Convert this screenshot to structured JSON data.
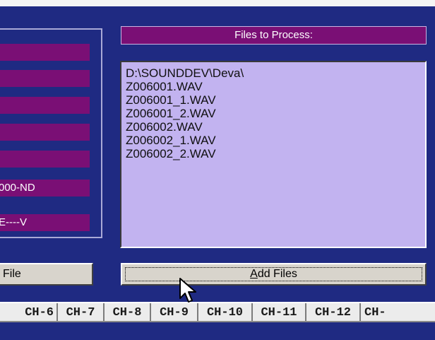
{
  "left_panel": {
    "fields": [
      "",
      "",
      "",
      "",
      "",
      "000-ND",
      "E----V"
    ]
  },
  "files": {
    "title": "Files to Process:",
    "items": [
      "D:\\SOUNDDEV\\Deva\\",
      "Z006001.WAV",
      "Z006001_1.WAV",
      "Z006001_2.WAV",
      "Z006002.WAV",
      "Z006002_1.WAV",
      "Z006002_2.WAV"
    ]
  },
  "buttons": {
    "left_label": "File",
    "add_files_mnemonic": "A",
    "add_files_rest": "dd Files"
  },
  "channel_tabs": [
    "CH-6",
    "CH-7",
    "CH-8",
    "CH-9",
    "CH-10",
    "CH-11",
    "CH-12",
    "CH-"
  ],
  "colors": {
    "background": "#1f2a82",
    "field_purple": "#7a0f75",
    "list_lavender": "#c2b3f0"
  }
}
